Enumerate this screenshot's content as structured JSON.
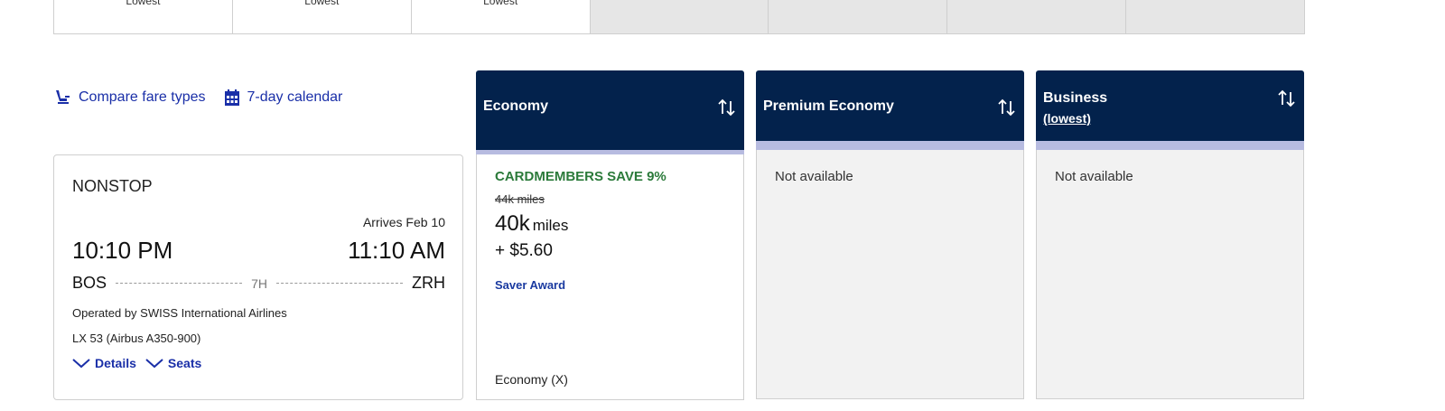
{
  "date_strip": {
    "cells": [
      {
        "label": "Lowest"
      },
      {
        "label": "Lowest"
      },
      {
        "label": "Lowest"
      },
      {
        "label": ""
      },
      {
        "label": ""
      },
      {
        "label": ""
      },
      {
        "label": ""
      }
    ]
  },
  "links": {
    "compare": "Compare fare types",
    "calendar": "7-day calendar"
  },
  "flight": {
    "stops": "NONSTOP",
    "arrives": "Arrives Feb 10",
    "depart_time": "10:10 PM",
    "arrive_time": "11:10 AM",
    "origin": "BOS",
    "duration": "7H",
    "destination": "ZRH",
    "operated_by": "Operated by SWISS International Airlines",
    "flight_number": "LX 53 (Airbus A350-900)",
    "details": "Details",
    "seats": "Seats"
  },
  "fares": {
    "economy": {
      "title": "Economy",
      "promo": "CARDMEMBERS SAVE 9%",
      "original_price": "44k miles",
      "miles": "40k",
      "miles_unit": "miles",
      "fee": "+ $5.60",
      "award": "Saver Award",
      "cabin": "Economy (X)"
    },
    "premium": {
      "title": "Premium Economy",
      "status": "Not available"
    },
    "business": {
      "title": "Business",
      "subtitle": "(lowest)",
      "status": "Not available"
    }
  },
  "colors": {
    "header_navy": "#03224c",
    "band_lavender": "#b7bbe0",
    "link_blue": "#1a2fa8",
    "promo_green": "#2b7a3a"
  }
}
